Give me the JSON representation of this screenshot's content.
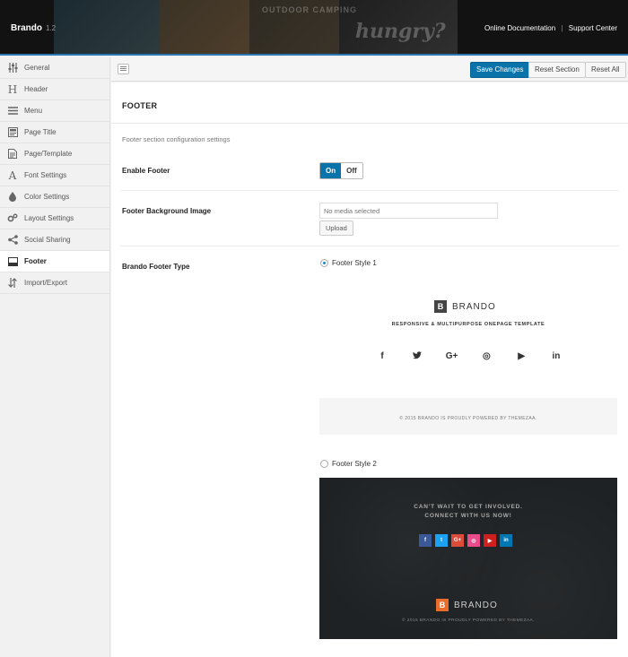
{
  "header": {
    "brand": "Brando",
    "version": "1.2",
    "hero_text_1": "OUTDOOR CAMPING",
    "hero_text_2": "hungry?",
    "links": [
      "Online Documentation",
      "Support Center"
    ],
    "link_separator": "|"
  },
  "sidebar": {
    "items": [
      {
        "label": "General",
        "icon": "sliders-icon"
      },
      {
        "label": "Header",
        "icon": "heading-icon"
      },
      {
        "label": "Menu",
        "icon": "menu-icon"
      },
      {
        "label": "Page Title",
        "icon": "page-title-icon"
      },
      {
        "label": "Page/Template",
        "icon": "document-icon"
      },
      {
        "label": "Font Settings",
        "icon": "font-icon"
      },
      {
        "label": "Color Settings",
        "icon": "drop-icon"
      },
      {
        "label": "Layout Settings",
        "icon": "cogs-icon"
      },
      {
        "label": "Social Sharing",
        "icon": "share-icon"
      },
      {
        "label": "Footer",
        "icon": "footer-icon",
        "active": true
      },
      {
        "label": "Import/Export",
        "icon": "import-export-icon"
      }
    ]
  },
  "toolbar": {
    "save_label": "Save Changes",
    "reset_section_label": "Reset Section",
    "reset_all_label": "Reset All"
  },
  "section": {
    "title": "FOOTER",
    "description": "Footer section configuration settings"
  },
  "fields": {
    "enable_footer": {
      "label": "Enable Footer",
      "on_label": "On",
      "off_label": "Off",
      "value": "On"
    },
    "background_image": {
      "label": "Footer Background Image",
      "placeholder": "No media selected",
      "upload_label": "Upload"
    },
    "footer_type": {
      "label": "Brando Footer Type",
      "selected": "Footer Style 1",
      "options": [
        {
          "label": "Footer Style 1",
          "logo_letter": "B",
          "logo_text": "BRANDO",
          "tagline": "RESPONSIVE & MULTIPURPOSE ONEPAGE TEMPLATE",
          "social": [
            "f",
            "t",
            "G+",
            "◎",
            "▶",
            "in"
          ],
          "copyright": "© 2015 BRANDO IS PROUDLY POWERED BY THEMEZAA."
        },
        {
          "label": "Footer Style 2",
          "heading_line1": "CAN'T WAIT TO GET INVOLVED.",
          "heading_line2": "CONNECT WITH US NOW!",
          "social": [
            "f",
            "t",
            "G+",
            "◎",
            "▶",
            "in"
          ],
          "logo_letter": "B",
          "logo_text": "BRANDO",
          "copyright": "© 2015 BRANDO IS PROUDLY POWERED BY THEMEZAA."
        }
      ]
    }
  },
  "colors": {
    "primary": "#0a73aa",
    "accent_orange": "#e96c2b",
    "social_style2": [
      "#3b5998",
      "#1da1f2",
      "#dd4b39",
      "#ea4c89",
      "#cd201f",
      "#0077b5"
    ]
  }
}
